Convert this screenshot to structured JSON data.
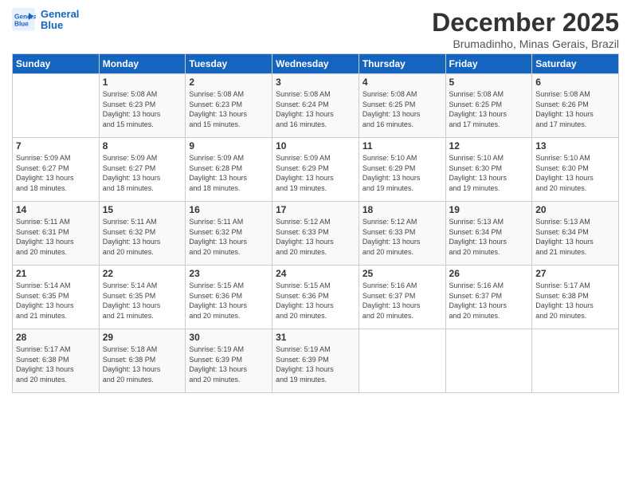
{
  "logo": {
    "line1": "General",
    "line2": "Blue"
  },
  "header": {
    "month": "December 2025",
    "location": "Brumadinho, Minas Gerais, Brazil"
  },
  "days_of_week": [
    "Sunday",
    "Monday",
    "Tuesday",
    "Wednesday",
    "Thursday",
    "Friday",
    "Saturday"
  ],
  "weeks": [
    [
      {
        "day": "",
        "info": ""
      },
      {
        "day": "1",
        "info": "Sunrise: 5:08 AM\nSunset: 6:23 PM\nDaylight: 13 hours\nand 15 minutes."
      },
      {
        "day": "2",
        "info": "Sunrise: 5:08 AM\nSunset: 6:23 PM\nDaylight: 13 hours\nand 15 minutes."
      },
      {
        "day": "3",
        "info": "Sunrise: 5:08 AM\nSunset: 6:24 PM\nDaylight: 13 hours\nand 16 minutes."
      },
      {
        "day": "4",
        "info": "Sunrise: 5:08 AM\nSunset: 6:25 PM\nDaylight: 13 hours\nand 16 minutes."
      },
      {
        "day": "5",
        "info": "Sunrise: 5:08 AM\nSunset: 6:25 PM\nDaylight: 13 hours\nand 17 minutes."
      },
      {
        "day": "6",
        "info": "Sunrise: 5:08 AM\nSunset: 6:26 PM\nDaylight: 13 hours\nand 17 minutes."
      }
    ],
    [
      {
        "day": "7",
        "info": "Sunrise: 5:09 AM\nSunset: 6:27 PM\nDaylight: 13 hours\nand 18 minutes."
      },
      {
        "day": "8",
        "info": "Sunrise: 5:09 AM\nSunset: 6:27 PM\nDaylight: 13 hours\nand 18 minutes."
      },
      {
        "day": "9",
        "info": "Sunrise: 5:09 AM\nSunset: 6:28 PM\nDaylight: 13 hours\nand 18 minutes."
      },
      {
        "day": "10",
        "info": "Sunrise: 5:09 AM\nSunset: 6:29 PM\nDaylight: 13 hours\nand 19 minutes."
      },
      {
        "day": "11",
        "info": "Sunrise: 5:10 AM\nSunset: 6:29 PM\nDaylight: 13 hours\nand 19 minutes."
      },
      {
        "day": "12",
        "info": "Sunrise: 5:10 AM\nSunset: 6:30 PM\nDaylight: 13 hours\nand 19 minutes."
      },
      {
        "day": "13",
        "info": "Sunrise: 5:10 AM\nSunset: 6:30 PM\nDaylight: 13 hours\nand 20 minutes."
      }
    ],
    [
      {
        "day": "14",
        "info": "Sunrise: 5:11 AM\nSunset: 6:31 PM\nDaylight: 13 hours\nand 20 minutes."
      },
      {
        "day": "15",
        "info": "Sunrise: 5:11 AM\nSunset: 6:32 PM\nDaylight: 13 hours\nand 20 minutes."
      },
      {
        "day": "16",
        "info": "Sunrise: 5:11 AM\nSunset: 6:32 PM\nDaylight: 13 hours\nand 20 minutes."
      },
      {
        "day": "17",
        "info": "Sunrise: 5:12 AM\nSunset: 6:33 PM\nDaylight: 13 hours\nand 20 minutes."
      },
      {
        "day": "18",
        "info": "Sunrise: 5:12 AM\nSunset: 6:33 PM\nDaylight: 13 hours\nand 20 minutes."
      },
      {
        "day": "19",
        "info": "Sunrise: 5:13 AM\nSunset: 6:34 PM\nDaylight: 13 hours\nand 20 minutes."
      },
      {
        "day": "20",
        "info": "Sunrise: 5:13 AM\nSunset: 6:34 PM\nDaylight: 13 hours\nand 21 minutes."
      }
    ],
    [
      {
        "day": "21",
        "info": "Sunrise: 5:14 AM\nSunset: 6:35 PM\nDaylight: 13 hours\nand 21 minutes."
      },
      {
        "day": "22",
        "info": "Sunrise: 5:14 AM\nSunset: 6:35 PM\nDaylight: 13 hours\nand 21 minutes."
      },
      {
        "day": "23",
        "info": "Sunrise: 5:15 AM\nSunset: 6:36 PM\nDaylight: 13 hours\nand 20 minutes."
      },
      {
        "day": "24",
        "info": "Sunrise: 5:15 AM\nSunset: 6:36 PM\nDaylight: 13 hours\nand 20 minutes."
      },
      {
        "day": "25",
        "info": "Sunrise: 5:16 AM\nSunset: 6:37 PM\nDaylight: 13 hours\nand 20 minutes."
      },
      {
        "day": "26",
        "info": "Sunrise: 5:16 AM\nSunset: 6:37 PM\nDaylight: 13 hours\nand 20 minutes."
      },
      {
        "day": "27",
        "info": "Sunrise: 5:17 AM\nSunset: 6:38 PM\nDaylight: 13 hours\nand 20 minutes."
      }
    ],
    [
      {
        "day": "28",
        "info": "Sunrise: 5:17 AM\nSunset: 6:38 PM\nDaylight: 13 hours\nand 20 minutes."
      },
      {
        "day": "29",
        "info": "Sunrise: 5:18 AM\nSunset: 6:38 PM\nDaylight: 13 hours\nand 20 minutes."
      },
      {
        "day": "30",
        "info": "Sunrise: 5:19 AM\nSunset: 6:39 PM\nDaylight: 13 hours\nand 20 minutes."
      },
      {
        "day": "31",
        "info": "Sunrise: 5:19 AM\nSunset: 6:39 PM\nDaylight: 13 hours\nand 19 minutes."
      },
      {
        "day": "",
        "info": ""
      },
      {
        "day": "",
        "info": ""
      },
      {
        "day": "",
        "info": ""
      }
    ]
  ]
}
